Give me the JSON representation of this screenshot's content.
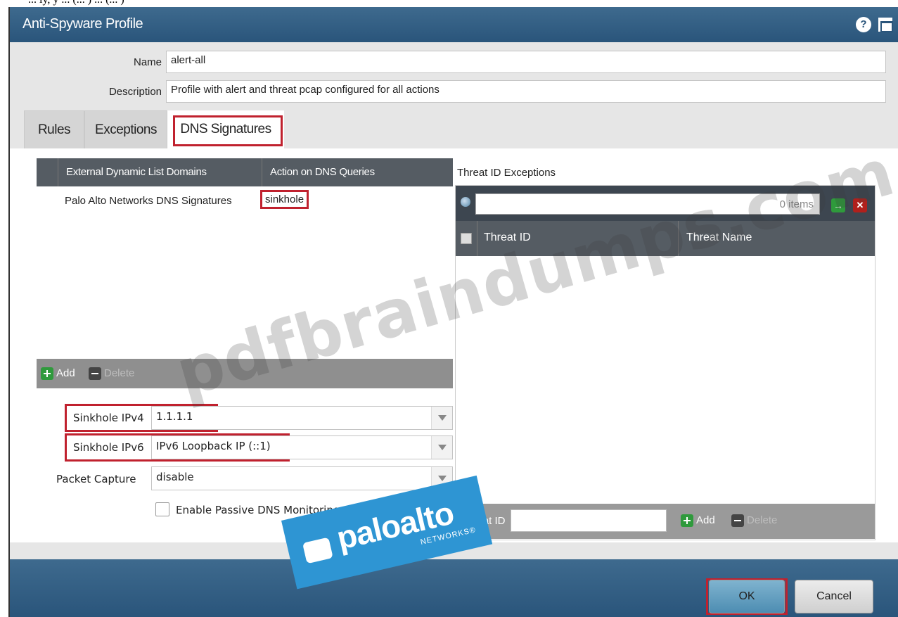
{
  "top_strip_text": "... ly, y ... (... ) ... (... )",
  "window": {
    "title": "Anti-Spyware Profile",
    "help_icon": "?"
  },
  "form": {
    "name_label": "Name",
    "name_value": "alert-all",
    "description_label": "Description",
    "description_value": "Profile with alert and threat pcap configured for all actions"
  },
  "tabs": [
    {
      "label": "Rules"
    },
    {
      "label": "Exceptions"
    },
    {
      "label": "DNS Signatures"
    }
  ],
  "edl_table": {
    "columns": [
      "External Dynamic List Domains",
      "Action on DNS Queries"
    ],
    "rows": [
      {
        "domain": "Palo Alto Networks DNS Signatures",
        "action": "sinkhole"
      }
    ],
    "add_label": "Add",
    "delete_label": "Delete"
  },
  "sinkhole": {
    "ipv4_label": "Sinkhole IPv4",
    "ipv4_value": "1.1.1.1",
    "ipv6_label": "Sinkhole IPv6",
    "ipv6_value": "IPv6 Loopback IP (::1)",
    "pcap_label": "Packet Capture",
    "pcap_value": "disable",
    "passive_dns_label": "Enable Passive DNS Monitoring"
  },
  "threat_exceptions": {
    "title": "Threat ID Exceptions",
    "items_count": "0 items",
    "columns": [
      "Threat ID",
      "Threat Name"
    ],
    "footer_label": "Threat ID",
    "add_label": "Add",
    "delete_label": "Delete"
  },
  "footer": {
    "ok_label": "OK",
    "cancel_label": "Cancel"
  },
  "watermark": "pdfbraindumps.com",
  "logo": {
    "word": "paloalto",
    "sub": "NETWORKS®"
  },
  "colors": {
    "titlebar": "#2a557b",
    "highlight": "#c0212e",
    "header_gray": "#555c63"
  }
}
